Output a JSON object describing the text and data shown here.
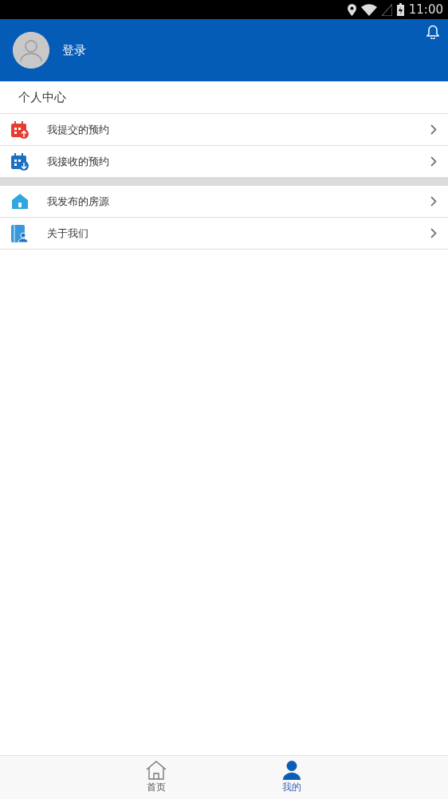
{
  "status_bar": {
    "time": "11:00"
  },
  "header": {
    "login": "登录"
  },
  "section_title": "个人中心",
  "groups": [
    {
      "items": [
        {
          "label": "我提交的预约",
          "kind": "submit"
        },
        {
          "label": "我接收的预约",
          "kind": "receive"
        }
      ]
    },
    {
      "items": [
        {
          "label": "我发布的房源",
          "kind": "house"
        },
        {
          "label": "关于我们",
          "kind": "about"
        }
      ]
    }
  ],
  "tabs": [
    {
      "label": "首页",
      "kind": "home",
      "selected": false
    },
    {
      "label": "我的",
      "kind": "me",
      "selected": true
    }
  ]
}
